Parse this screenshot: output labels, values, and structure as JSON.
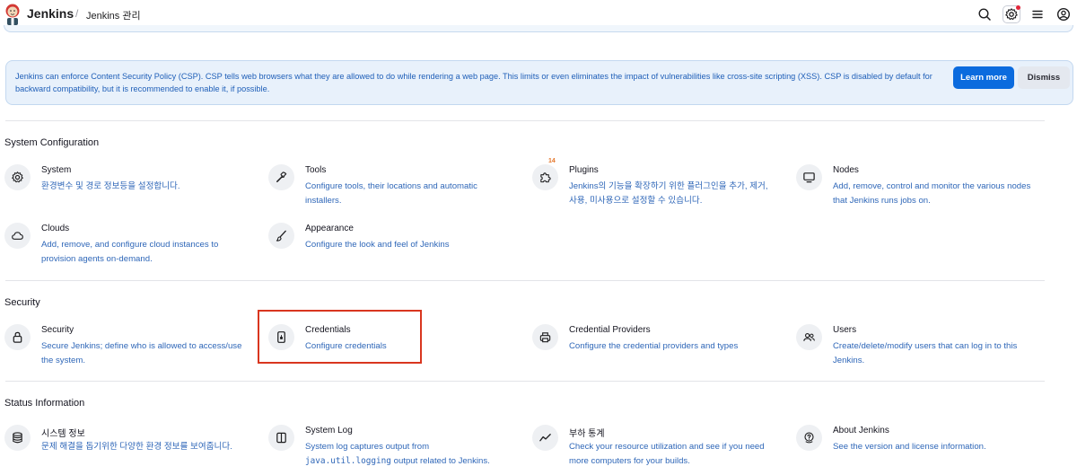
{
  "header": {
    "brand": "Jenkins",
    "breadcrumb_sep": "/",
    "breadcrumb": "Jenkins 관리"
  },
  "banner": {
    "text": "Jenkins can enforce Content Security Policy (CSP). CSP tells web browsers what they are allowed to do while rendering a web page. This limits or even eliminates the impact of vulnerabilities like cross-site scripting (XSS). CSP is disabled by default for backward compatibility, but it is recommended to enable it, if possible.",
    "learn_more": "Learn more",
    "dismiss": "Dismiss"
  },
  "sections": {
    "system_configuration": {
      "title": "System Configuration",
      "items": [
        {
          "title": "System",
          "desc": "환경변수 및 경로 정보등을 설정합니다."
        },
        {
          "title": "Tools",
          "desc": "Configure tools, their locations and automatic installers."
        },
        {
          "title": "Plugins",
          "desc": "Jenkins의 기능을 확장하기 위한 플러그인을 추가, 제거, 사용, 미사용으로 설정할 수 있습니다.",
          "badge": "14"
        },
        {
          "title": "Nodes",
          "desc": "Add, remove, control and monitor the various nodes that Jenkins runs jobs on."
        },
        {
          "title": "Clouds",
          "desc": "Add, remove, and configure cloud instances to provision agents on-demand."
        },
        {
          "title": "Appearance",
          "desc": "Configure the look and feel of Jenkins"
        }
      ]
    },
    "security": {
      "title": "Security",
      "items": [
        {
          "title": "Security",
          "desc": "Secure Jenkins; define who is allowed to access/use the system."
        },
        {
          "title": "Credentials",
          "desc": "Configure credentials"
        },
        {
          "title": "Credential Providers",
          "desc": "Configure the credential providers and types"
        },
        {
          "title": "Users",
          "desc": "Create/delete/modify users that can log in to this Jenkins."
        }
      ]
    },
    "status_information": {
      "title": "Status Information",
      "items": [
        {
          "title": "시스템 정보",
          "desc": "문제 해결을 돕기위한 다양한 환경 정보를 보여줍니다."
        },
        {
          "title": "System Log",
          "desc_pre": "System log captures output from ",
          "desc_code": "java.util.logging",
          "desc_post": " output related to Jenkins."
        },
        {
          "title": "부하 통계",
          "desc": "Check your resource utilization and see if you need more computers for your builds."
        },
        {
          "title": "About Jenkins",
          "desc": "See the version and license information."
        }
      ]
    }
  },
  "colors": {
    "link": "#2f67b8",
    "primary_button": "#0b6bde",
    "banner_bg": "#e8f1fb",
    "highlight": "#d9361f"
  },
  "icons": {
    "header": [
      "search-icon",
      "gear-icon",
      "menu-icon",
      "user-icon"
    ],
    "system_configuration": [
      "gear-icon",
      "hammer-icon",
      "puzzle-icon",
      "monitor-icon",
      "cloud-icon",
      "brush-icon"
    ],
    "security": [
      "lock-icon",
      "phone-key-icon",
      "printer-icon",
      "users-icon"
    ],
    "status_information": [
      "database-icon",
      "log-icon",
      "trend-icon",
      "help-icon"
    ]
  }
}
